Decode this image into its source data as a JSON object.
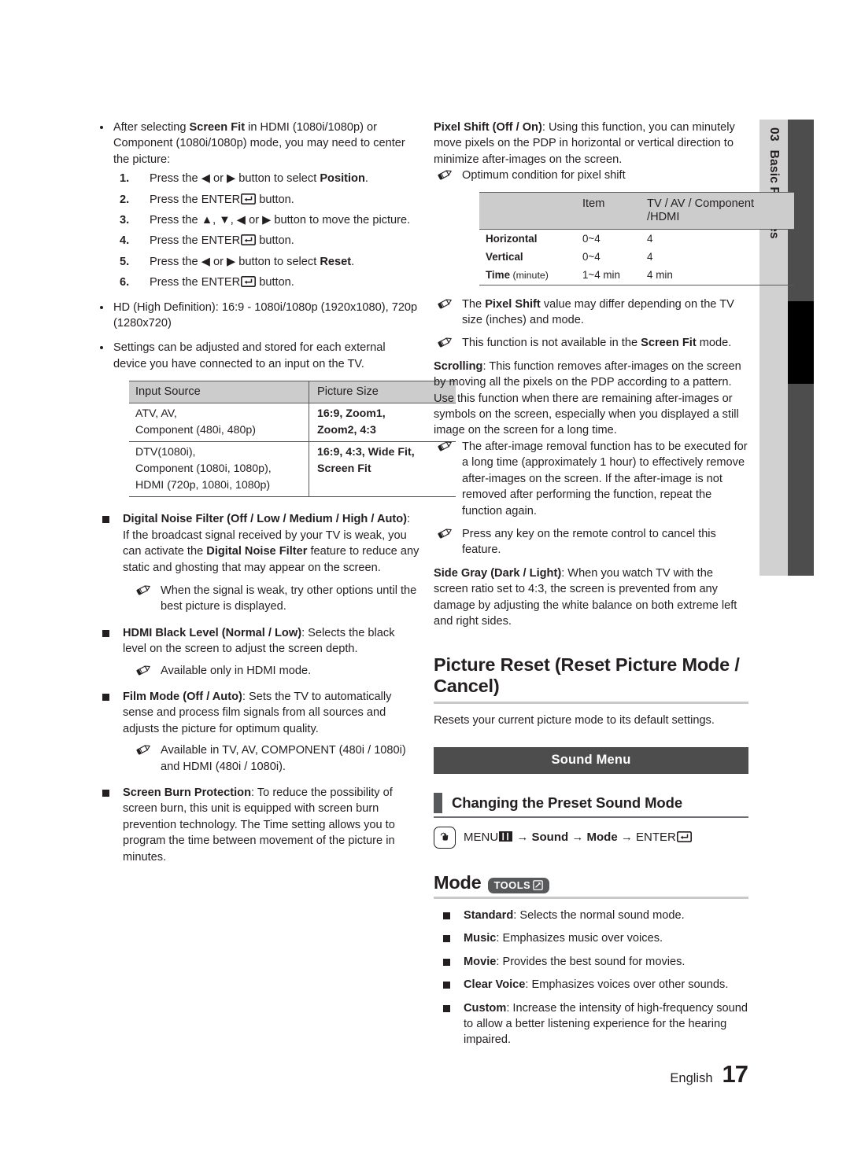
{
  "chapter_tab": {
    "number": "03",
    "label": "Basic Features"
  },
  "footer": {
    "language": "English",
    "page_number": "17"
  },
  "left_column": {
    "bullet_screen_fit": {
      "text_before": "After selecting ",
      "bold1": "Screen Fit",
      "text_after": " in HDMI (1080i/1080p) or Component (1080i/1080p) mode, you may need to center the picture:",
      "steps": [
        {
          "n": "1.",
          "pre": "Press the ◀ or ▶ button to select ",
          "bold": "Position",
          "post": "."
        },
        {
          "n": "2.",
          "pre": "Press the ENTER",
          "bold": "",
          "post": " button."
        },
        {
          "n": "3.",
          "pre": "Press the ▲, ▼, ◀ or ▶ button to move the picture.",
          "bold": "",
          "post": ""
        },
        {
          "n": "4.",
          "pre": "Press the ENTER",
          "bold": "",
          "post": " button."
        },
        {
          "n": "5.",
          "pre": "Press the ◀ or ▶ button to select ",
          "bold": "Reset",
          "post": "."
        },
        {
          "n": "6.",
          "pre": "Press the ENTER",
          "bold": "",
          "post": " button."
        }
      ]
    },
    "bullet_hd": "HD (High Definition): 16:9 - 1080i/1080p (1920x1080), 720p (1280x720)",
    "bullet_settings": "Settings can be adjusted and stored for each external device you have connected to an input on the TV.",
    "picture_size_table": {
      "headers": [
        "Input Source",
        "Picture Size"
      ],
      "rows": [
        {
          "source": "ATV, AV,\nComponent (480i, 480p)",
          "size": "16:9, Zoom1,\nZoom2, 4:3"
        },
        {
          "source": "DTV(1080i),\nComponent (1080i, 1080p),\nHDMI (720p, 1080i, 1080p)",
          "size": "16:9, 4:3, Wide Fit,\nScreen Fit"
        }
      ]
    },
    "features": [
      {
        "title": "Digital Noise Filter (Off / Low / Medium / High / Auto)",
        "body_pre": ": If the broadcast signal received by your TV is weak, you can activate the ",
        "body_bold": "Digital Noise Filter",
        "body_post": " feature to reduce any static and ghosting that may appear on the screen.",
        "notes": [
          "When the signal is weak, try other options until the best picture is displayed."
        ]
      },
      {
        "title": "HDMI Black Level (Normal / Low)",
        "body_pre": ": Selects the black level on the screen to adjust the screen depth.",
        "body_bold": "",
        "body_post": "",
        "notes": [
          "Available only in HDMI mode."
        ]
      },
      {
        "title": "Film Mode (Off / Auto)",
        "body_pre": ": Sets the TV to automatically sense and process film signals from all sources and adjusts the picture for optimum quality.",
        "body_bold": "",
        "body_post": "",
        "notes": [
          "Available in TV, AV, COMPONENT (480i / 1080i) and HDMI (480i / 1080i)."
        ]
      },
      {
        "title": "Screen Burn Protection",
        "body_pre": ": To reduce the possibility of screen burn, this unit is equipped with screen burn prevention technology. The Time setting allows you to program the time between movement of the picture in minutes.",
        "body_bold": "",
        "body_post": "",
        "notes": []
      }
    ]
  },
  "right_column": {
    "pixel_shift": {
      "title": "Pixel Shift (Off / On)",
      "body": ": Using this function, you can minutely move pixels on the PDP in horizontal or vertical direction to minimize after-images on the screen.",
      "note_intro": "Optimum condition for pixel shift",
      "table": {
        "headers": [
          "",
          "Item",
          "TV / AV / Component\n/HDMI"
        ],
        "rows": [
          {
            "label": "Horizontal",
            "label_small": "",
            "item": "0~4",
            "value": "4"
          },
          {
            "label": "Vertical",
            "label_small": "",
            "item": "0~4",
            "value": "4"
          },
          {
            "label": "Time",
            "label_small": " (minute)",
            "item": "1~4 min",
            "value": "4 min"
          }
        ]
      },
      "notes": [
        {
          "pre": "The ",
          "bold": "Pixel Shift",
          "post": " value may differ depending on the TV size (inches) and mode."
        },
        {
          "pre": "This function is not available in the ",
          "bold": "Screen Fit",
          "post": " mode."
        }
      ]
    },
    "scrolling": {
      "title": "Scrolling",
      "body": ": This function removes after-images on the screen by moving all the pixels on the PDP according to a pattern. Use this function when there are remaining after-images or symbols on the screen, especially when you displayed a still image on the screen for a long time.",
      "notes": [
        "The after-image removal function has to be executed for a long time (approximately 1 hour) to effectively remove after-images on the screen. If the after-image is not removed after performing the function, repeat the function again.",
        "Press any key on the remote control to cancel this feature."
      ]
    },
    "side_gray": {
      "title": "Side Gray (Dark / Light)",
      "body": ": When you watch TV with the screen ratio set to 4:3, the screen is prevented from any damage by adjusting the white balance on both extreme left and right sides."
    },
    "picture_reset": {
      "heading": "Picture Reset (Reset Picture Mode / Cancel)",
      "body": "Resets your current picture mode to its default settings."
    },
    "sound_menu_band": "Sound Menu",
    "preset_section": {
      "heading": "Changing the Preset Sound Mode",
      "menu_path": {
        "menu": "MENU",
        "sep": "→",
        "item1": "Sound",
        "item2": "Mode",
        "enter": "ENTER"
      }
    },
    "mode_section": {
      "title": "Mode",
      "tools_label": "TOOLS",
      "items": [
        {
          "name": "Standard",
          "desc": ": Selects the normal sound mode."
        },
        {
          "name": "Music",
          "desc": ": Emphasizes music over voices."
        },
        {
          "name": "Movie",
          "desc": ": Provides the best sound for movies."
        },
        {
          "name": "Clear Voice",
          "desc": ": Emphasizes voices over other sounds."
        },
        {
          "name": "Custom",
          "desc": ": Increase the intensity of high-frequency sound to allow a better listening experience for the hearing impaired."
        }
      ]
    }
  },
  "colors": {
    "band_dark": "#4d4d4d",
    "tab_light": "#d1d1d1",
    "table_header": "#cccccc",
    "text": "#231f20"
  }
}
